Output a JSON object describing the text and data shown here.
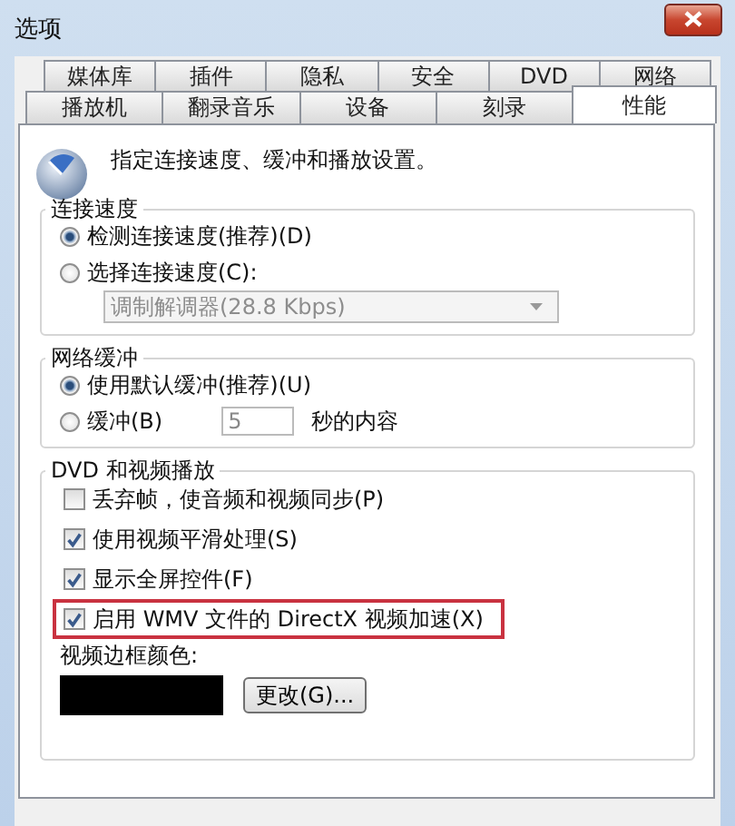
{
  "window": {
    "title": "选项"
  },
  "tab_rows": [
    [
      {
        "label": "媒体库",
        "selected": false
      },
      {
        "label": "插件",
        "selected": false
      },
      {
        "label": "隐私",
        "selected": false
      },
      {
        "label": "安全",
        "selected": false
      },
      {
        "label": "DVD",
        "selected": false
      },
      {
        "label": "网络",
        "selected": false
      }
    ],
    [
      {
        "label": "播放机",
        "selected": false
      },
      {
        "label": "翻录音乐",
        "selected": false
      },
      {
        "label": "设备",
        "selected": false
      },
      {
        "label": "刻录",
        "selected": false
      },
      {
        "label": "性能",
        "selected": true
      }
    ]
  ],
  "description": "指定连接速度、缓冲和播放设置。",
  "connection_speed": {
    "title": "连接速度",
    "options": [
      {
        "label": "检测连接速度(推荐)(D)",
        "selected": true
      },
      {
        "label": "选择连接速度(C):",
        "selected": false
      }
    ],
    "dropdown": {
      "value": "调制解调器(28.8 Kbps)",
      "disabled": true
    }
  },
  "network_buffer": {
    "title": "网络缓冲",
    "options": [
      {
        "kind": "plain",
        "label": "使用默认缓冲(推荐)(U)",
        "selected": true
      },
      {
        "kind": "seconds",
        "label": "缓冲(B)",
        "selected": false,
        "value": "5",
        "suffix": "秒的内容"
      }
    ]
  },
  "dvd_video": {
    "title": "DVD 和视频播放",
    "checkboxes": [
      {
        "label": "丢弃帧，使音频和视频同步(P)",
        "checked": false,
        "highlighted": false
      },
      {
        "label": "使用视频平滑处理(S)",
        "checked": true,
        "highlighted": false
      },
      {
        "label": "显示全屏控件(F)",
        "checked": true,
        "highlighted": false
      },
      {
        "label": "启用 WMV 文件的 DirectX 视频加速(X)",
        "checked": true,
        "highlighted": true
      }
    ],
    "border_color_label": "视频边框颜色:",
    "change_button": "更改(G)..."
  }
}
